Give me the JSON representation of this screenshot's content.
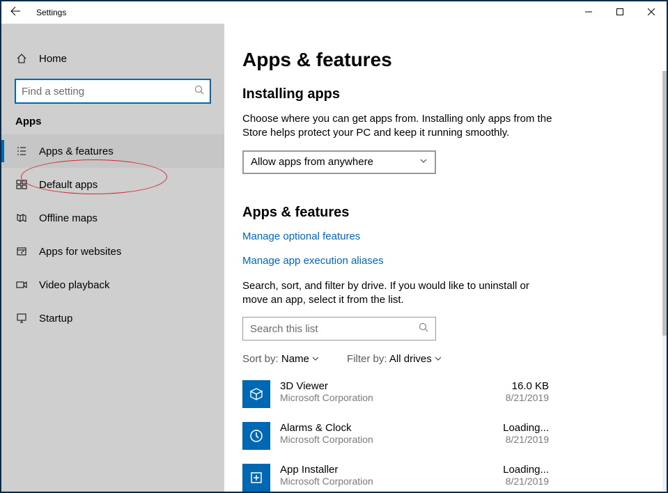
{
  "window": {
    "title": "Settings"
  },
  "sidebar": {
    "home_label": "Home",
    "search_placeholder": "Find a setting",
    "group_label": "Apps",
    "items": [
      {
        "label": "Apps & features"
      },
      {
        "label": "Default apps"
      },
      {
        "label": "Offline maps"
      },
      {
        "label": "Apps for websites"
      },
      {
        "label": "Video playback"
      },
      {
        "label": "Startup"
      }
    ]
  },
  "page": {
    "title": "Apps & features",
    "installing": {
      "heading": "Installing apps",
      "desc": "Choose where you can get apps from. Installing only apps from the Store helps protect your PC and keep it running smoothly.",
      "combo_value": "Allow apps from anywhere"
    },
    "list": {
      "heading": "Apps & features",
      "link_optional": "Manage optional features",
      "link_aliases": "Manage app execution aliases",
      "desc": "Search, sort, and filter by drive. If you would like to uninstall or move an app, select it from the list.",
      "search_placeholder": "Search this list",
      "sort_label": "Sort by:",
      "sort_value": "Name",
      "filter_label": "Filter by:",
      "filter_value": "All drives",
      "apps": [
        {
          "name": "3D Viewer",
          "publisher": "Microsoft Corporation",
          "size": "16.0 KB",
          "date": "8/21/2019"
        },
        {
          "name": "Alarms & Clock",
          "publisher": "Microsoft Corporation",
          "size": "Loading...",
          "date": "8/21/2019"
        },
        {
          "name": "App Installer",
          "publisher": "Microsoft Corporation",
          "size": "Loading...",
          "date": "8/21/2019"
        }
      ]
    }
  }
}
